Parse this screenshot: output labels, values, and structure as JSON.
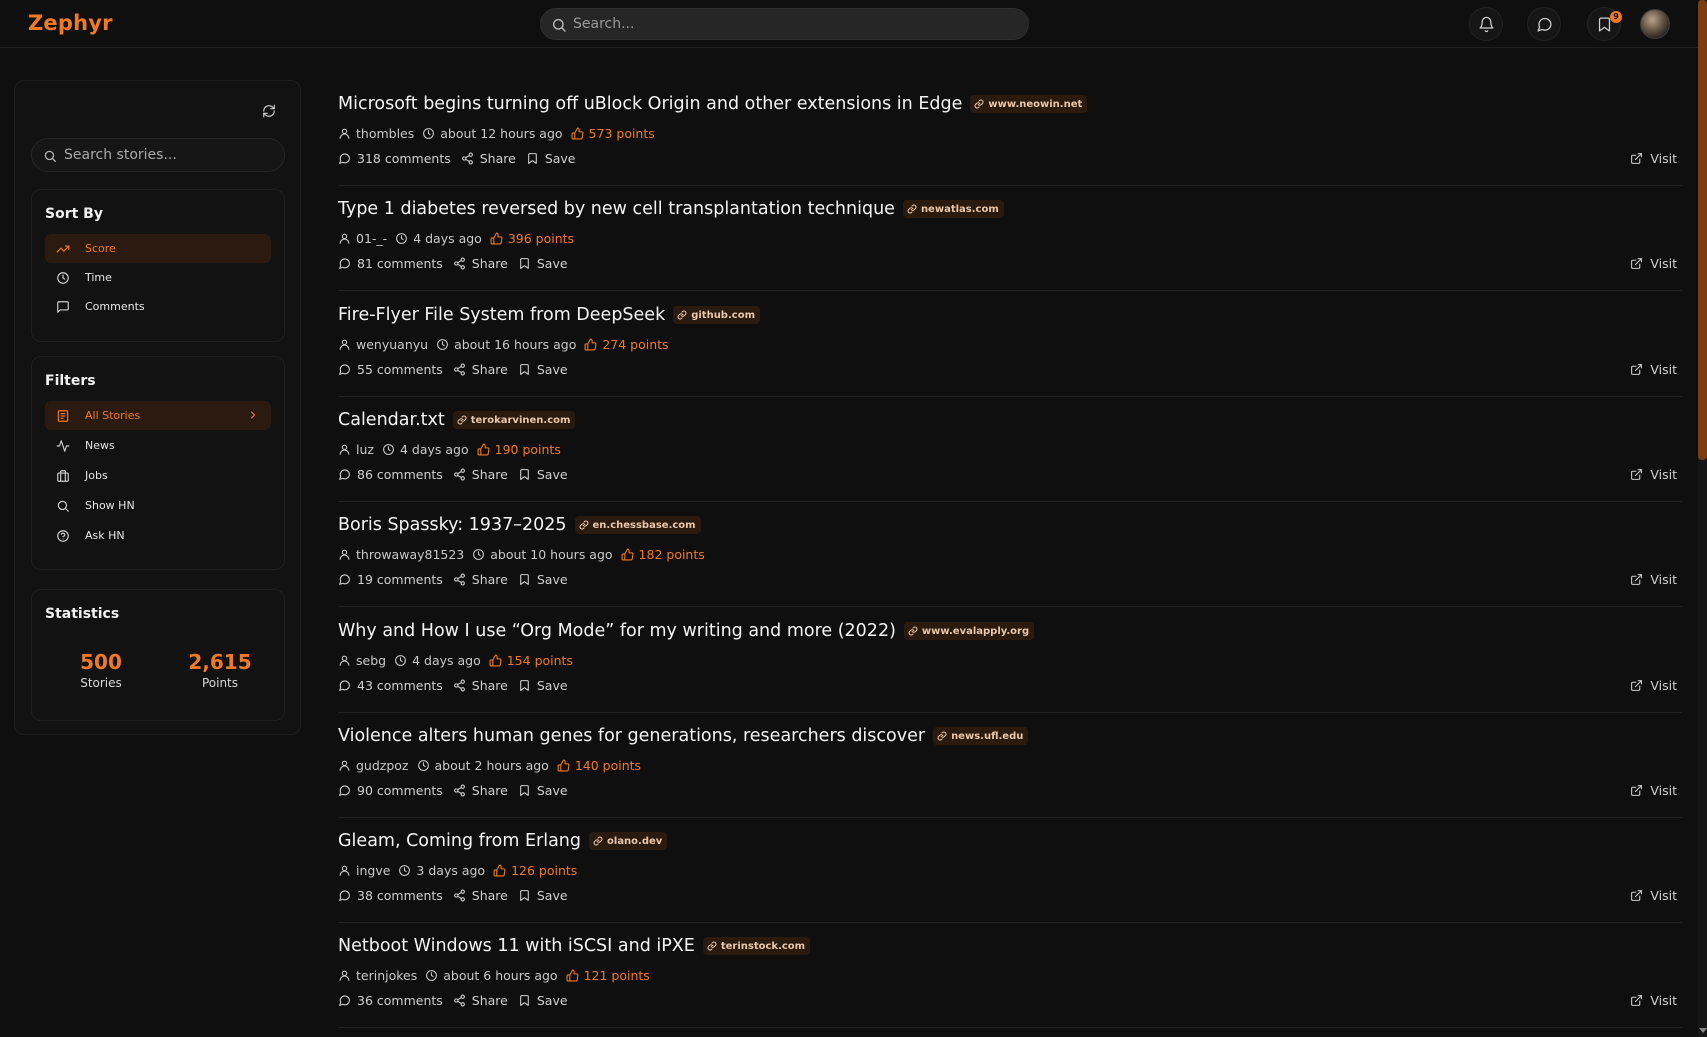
{
  "header": {
    "logo": "Zephyr",
    "search_placeholder": "Search...",
    "bookmark_badge": "9"
  },
  "sidebar": {
    "search_placeholder": "Search stories...",
    "sort": {
      "title": "Sort By",
      "items": [
        {
          "label": "Score",
          "icon": "trending-up-icon",
          "active": true
        },
        {
          "label": "Time",
          "icon": "clock-icon",
          "active": false
        },
        {
          "label": "Comments",
          "icon": "comment-icon",
          "active": false
        }
      ]
    },
    "filters": {
      "title": "Filters",
      "items": [
        {
          "label": "All Stories",
          "icon": "newspaper-icon",
          "active": true
        },
        {
          "label": "News",
          "icon": "activity-icon",
          "active": false
        },
        {
          "label": "Jobs",
          "icon": "briefcase-icon",
          "active": false
        },
        {
          "label": "Show HN",
          "icon": "search-icon",
          "active": false
        },
        {
          "label": "Ask HN",
          "icon": "help-circle-icon",
          "active": false
        }
      ]
    },
    "statistics": {
      "title": "Statistics",
      "stories_value": "500",
      "stories_label": "Stories",
      "points_value": "2,615",
      "points_label": "Points"
    }
  },
  "actions": {
    "share": "Share",
    "save": "Save",
    "visit": "Visit"
  },
  "stories": [
    {
      "title": "Microsoft begins turning off uBlock Origin and other extensions in Edge",
      "domain": "www.neowin.net",
      "author": "thombles",
      "time": "about 12 hours ago",
      "points": "573 points",
      "comments": "318 comments"
    },
    {
      "title": "Type 1 diabetes reversed by new cell transplantation technique",
      "domain": "newatlas.com",
      "author": "01-_-",
      "time": "4 days ago",
      "points": "396 points",
      "comments": "81 comments"
    },
    {
      "title": "Fire-Flyer File System from DeepSeek",
      "domain": "github.com",
      "author": "wenyuanyu",
      "time": "about 16 hours ago",
      "points": "274 points",
      "comments": "55 comments"
    },
    {
      "title": "Calendar.txt",
      "domain": "terokarvinen.com",
      "author": "luz",
      "time": "4 days ago",
      "points": "190 points",
      "comments": "86 comments"
    },
    {
      "title": "Boris Spassky: 1937–2025",
      "domain": "en.chessbase.com",
      "author": "throwaway81523",
      "time": "about 10 hours ago",
      "points": "182 points",
      "comments": "19 comments"
    },
    {
      "title": "Why and How I use “Org Mode” for my writing and more (2022)",
      "domain": "www.evalapply.org",
      "author": "sebg",
      "time": "4 days ago",
      "points": "154 points",
      "comments": "43 comments"
    },
    {
      "title": "Violence alters human genes for generations, researchers discover",
      "domain": "news.ufl.edu",
      "author": "gudzpoz",
      "time": "about 2 hours ago",
      "points": "140 points",
      "comments": "90 comments"
    },
    {
      "title": "Gleam, Coming from Erlang",
      "domain": "olano.dev",
      "author": "ingve",
      "time": "3 days ago",
      "points": "126 points",
      "comments": "38 comments"
    },
    {
      "title": "Netboot Windows 11 with iSCSI and iPXE",
      "domain": "terinstock.com",
      "author": "terinjokes",
      "time": "about 6 hours ago",
      "points": "121 points",
      "comments": "36 comments"
    }
  ],
  "colors": {
    "accent": "#f07a23",
    "background": "#0f0f0f",
    "chip_bg": "#2b1a0e"
  }
}
